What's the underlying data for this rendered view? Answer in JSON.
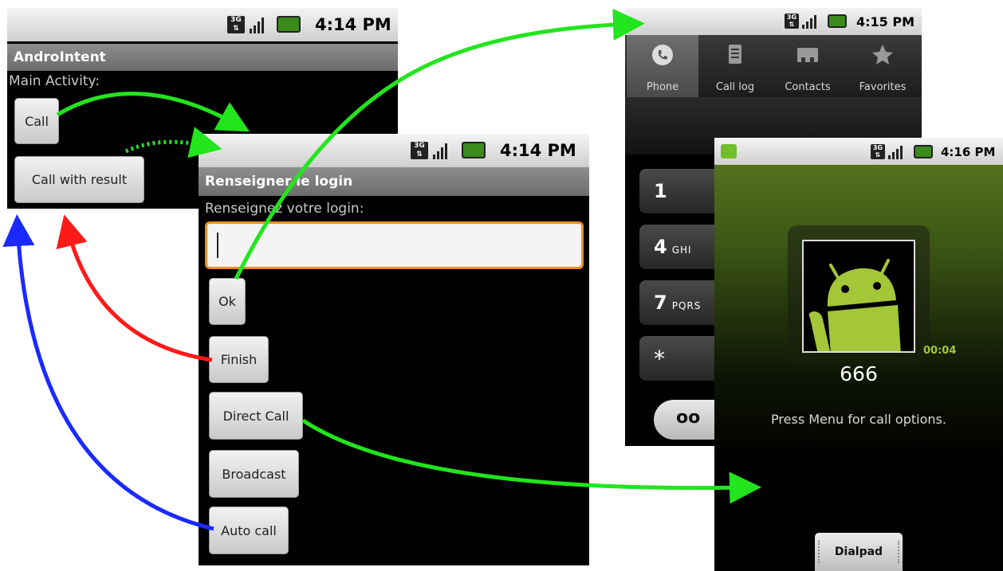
{
  "screen_main": {
    "status_time": "4:14 PM",
    "title": "AndroIntent",
    "label": "Main Activity:",
    "buttons": {
      "call": "Call",
      "call_with_result": "Call with result"
    }
  },
  "screen_login": {
    "status_time": "4:14 PM",
    "title": "Renseigner le login",
    "label": "Renseignez votre login:",
    "input_value": "",
    "buttons": {
      "ok": "Ok",
      "finish": "Finish",
      "direct_call": "Direct Call",
      "broadcast": "Broadcast",
      "auto_call": "Auto call"
    }
  },
  "screen_dialer": {
    "status_time": "4:15 PM",
    "tabs": [
      "Phone",
      "Call log",
      "Contacts",
      "Favorites"
    ],
    "keys": [
      {
        "digit": "1",
        "letters": ""
      },
      {
        "digit": "4",
        "letters": "GHI"
      },
      {
        "digit": "7",
        "letters": "PQRS"
      },
      {
        "digit": "*",
        "letters": ""
      }
    ],
    "voicemail_symbol": "oo"
  },
  "screen_incall": {
    "status_time": "4:16 PM",
    "timer": "00:04",
    "number": "666",
    "message": "Press Menu for call options.",
    "dialpad_label": "Dialpad"
  },
  "colors": {
    "green_arrow": "#22e51d",
    "red_arrow": "#ff1a1a",
    "blue_arrow": "#1a2aff",
    "input_focus": "#f08c1c",
    "android_green": "#a4c639",
    "incall_top": "#587a21"
  }
}
